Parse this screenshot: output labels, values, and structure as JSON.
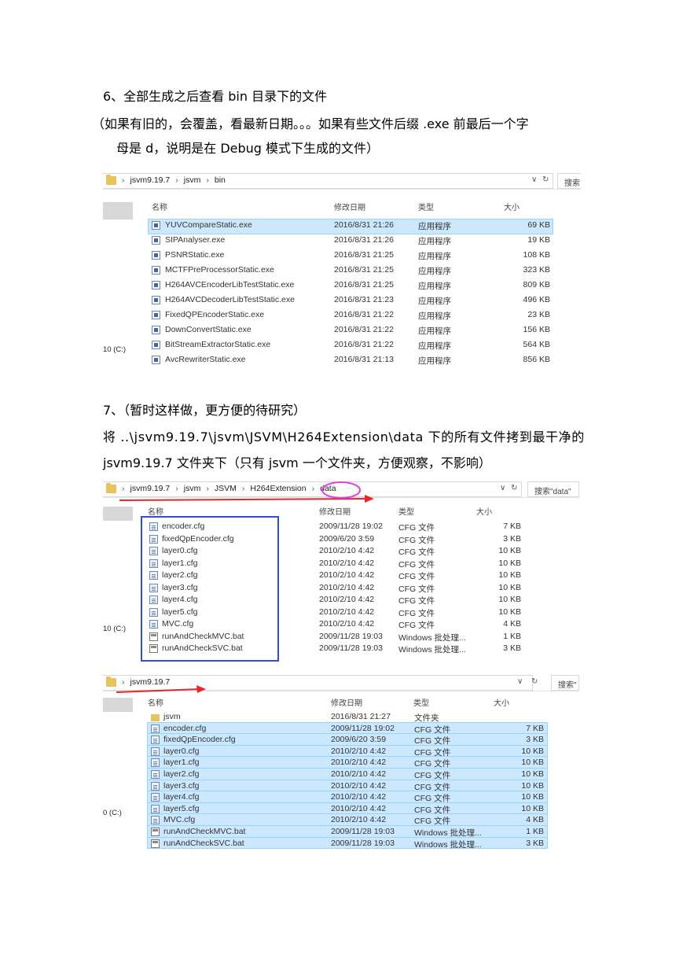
{
  "section6": {
    "heading": "6、全部生成之后查看 bin 目录下的文件",
    "note_line1": "（如果有旧的，会覆盖，看最新日期。。。如果有些文件后缀 .exe 前最后一个字",
    "note_line2": "母是 d，说明是在 Debug 模式下生成的文件）"
  },
  "section7": {
    "heading": "7、（暂时这样做，更方便的待研究）",
    "line1": "将 ..\\jsvm9.19.7\\jsvm\\JSVM\\H264Extension\\data 下的所有文件拷到最干净的",
    "line2": "jsvm9.19.7 文件夹下（只有 jsvm 一个文件夹，方便观察，不影响）"
  },
  "explorer1": {
    "breadcrumb": [
      "jsvm9.19.7",
      "jsvm",
      "bin"
    ],
    "refresh_icon": "refresh-icon",
    "dropdown_icon": "chevron-down-icon",
    "search_label": "搜索",
    "drive_label": "10 (C:)",
    "columns": {
      "name": "名称",
      "date": "修改日期",
      "type": "类型",
      "size": "大小"
    },
    "files": [
      {
        "name": "YUVCompareStatic.exe",
        "date": "2016/8/31 21:26",
        "type": "应用程序",
        "size": "69 KB",
        "selected": true
      },
      {
        "name": "SIPAnalyser.exe",
        "date": "2016/8/31 21:26",
        "type": "应用程序",
        "size": "19 KB"
      },
      {
        "name": "PSNRStatic.exe",
        "date": "2016/8/31 21:25",
        "type": "应用程序",
        "size": "108 KB"
      },
      {
        "name": "MCTFPreProcessorStatic.exe",
        "date": "2016/8/31 21:25",
        "type": "应用程序",
        "size": "323 KB"
      },
      {
        "name": "H264AVCEncoderLibTestStatic.exe",
        "date": "2016/8/31 21:25",
        "type": "应用程序",
        "size": "809 KB"
      },
      {
        "name": "H264AVCDecoderLibTestStatic.exe",
        "date": "2016/8/31 21:23",
        "type": "应用程序",
        "size": "496 KB"
      },
      {
        "name": "FixedQPEncoderStatic.exe",
        "date": "2016/8/31 21:22",
        "type": "应用程序",
        "size": "23 KB"
      },
      {
        "name": "DownConvertStatic.exe",
        "date": "2016/8/31 21:22",
        "type": "应用程序",
        "size": "156 KB"
      },
      {
        "name": "BitStreamExtractorStatic.exe",
        "date": "2016/8/31 21:22",
        "type": "应用程序",
        "size": "564 KB"
      },
      {
        "name": "AvcRewriterStatic.exe",
        "date": "2016/8/31 21:13",
        "type": "应用程序",
        "size": "856 KB"
      }
    ]
  },
  "explorer2": {
    "breadcrumb": [
      "jsvm9.19.7",
      "jsvm",
      "JSVM",
      "H264Extension",
      "data"
    ],
    "search_label": "搜索\"data\"",
    "drive_label": "10 (C:)",
    "columns": {
      "name": "名称",
      "date": "修改日期",
      "type": "类型",
      "size": "大小"
    },
    "files": [
      {
        "name": "encoder.cfg",
        "date": "2009/11/28 19:02",
        "type": "CFG 文件",
        "size": "7 KB",
        "icon": "cfg"
      },
      {
        "name": "fixedQpEncoder.cfg",
        "date": "2009/6/20 3:59",
        "type": "CFG 文件",
        "size": "3 KB",
        "icon": "cfg"
      },
      {
        "name": "layer0.cfg",
        "date": "2010/2/10 4:42",
        "type": "CFG 文件",
        "size": "10 KB",
        "icon": "cfg"
      },
      {
        "name": "layer1.cfg",
        "date": "2010/2/10 4:42",
        "type": "CFG 文件",
        "size": "10 KB",
        "icon": "cfg"
      },
      {
        "name": "layer2.cfg",
        "date": "2010/2/10 4:42",
        "type": "CFG 文件",
        "size": "10 KB",
        "icon": "cfg"
      },
      {
        "name": "layer3.cfg",
        "date": "2010/2/10 4:42",
        "type": "CFG 文件",
        "size": "10 KB",
        "icon": "cfg"
      },
      {
        "name": "layer4.cfg",
        "date": "2010/2/10 4:42",
        "type": "CFG 文件",
        "size": "10 KB",
        "icon": "cfg"
      },
      {
        "name": "layer5.cfg",
        "date": "2010/2/10 4:42",
        "type": "CFG 文件",
        "size": "10 KB",
        "icon": "cfg"
      },
      {
        "name": "MVC.cfg",
        "date": "2010/2/10 4:42",
        "type": "CFG 文件",
        "size": "4 KB",
        "icon": "cfg"
      },
      {
        "name": "runAndCheckMVC.bat",
        "date": "2009/11/28 19:03",
        "type": "Windows 批处理...",
        "size": "1 KB",
        "icon": "bat"
      },
      {
        "name": "runAndCheckSVC.bat",
        "date": "2009/11/28 19:03",
        "type": "Windows 批处理...",
        "size": "3 KB",
        "icon": "bat"
      }
    ]
  },
  "explorer3": {
    "breadcrumb": [
      "jsvm9.19.7"
    ],
    "search_label": "搜索\"",
    "drive_label": "0 (C:)",
    "columns": {
      "name": "名称",
      "date": "修改日期",
      "type": "类型",
      "size": "大小"
    },
    "files": [
      {
        "name": "jsvm",
        "date": "2016/8/31 21:27",
        "type": "文件夹",
        "size": "",
        "icon": "fld"
      },
      {
        "name": "encoder.cfg",
        "date": "2009/11/28 19:02",
        "type": "CFG 文件",
        "size": "7 KB",
        "icon": "cfg",
        "selected": true
      },
      {
        "name": "fixedQpEncoder.cfg",
        "date": "2009/6/20 3:59",
        "type": "CFG 文件",
        "size": "3 KB",
        "icon": "cfg",
        "selected": true
      },
      {
        "name": "layer0.cfg",
        "date": "2010/2/10 4:42",
        "type": "CFG 文件",
        "size": "10 KB",
        "icon": "cfg",
        "selected": true
      },
      {
        "name": "layer1.cfg",
        "date": "2010/2/10 4:42",
        "type": "CFG 文件",
        "size": "10 KB",
        "icon": "cfg",
        "selected": true
      },
      {
        "name": "layer2.cfg",
        "date": "2010/2/10 4:42",
        "type": "CFG 文件",
        "size": "10 KB",
        "icon": "cfg",
        "selected": true
      },
      {
        "name": "layer3.cfg",
        "date": "2010/2/10 4:42",
        "type": "CFG 文件",
        "size": "10 KB",
        "icon": "cfg",
        "selected": true
      },
      {
        "name": "layer4.cfg",
        "date": "2010/2/10 4:42",
        "type": "CFG 文件",
        "size": "10 KB",
        "icon": "cfg",
        "selected": true
      },
      {
        "name": "layer5.cfg",
        "date": "2010/2/10 4:42",
        "type": "CFG 文件",
        "size": "10 KB",
        "icon": "cfg",
        "selected": true
      },
      {
        "name": "MVC.cfg",
        "date": "2010/2/10 4:42",
        "type": "CFG 文件",
        "size": "4 KB",
        "icon": "cfg",
        "selected": true
      },
      {
        "name": "runAndCheckMVC.bat",
        "date": "2009/11/28 19:03",
        "type": "Windows 批处理...",
        "size": "1 KB",
        "icon": "bat",
        "selected": true
      },
      {
        "name": "runAndCheckSVC.bat",
        "date": "2009/11/28 19:03",
        "type": "Windows 批处理...",
        "size": "3 KB",
        "icon": "bat",
        "selected": true
      }
    ]
  },
  "colors": {
    "selection_fill": "#cce8ff",
    "selection_border": "#99d1ff",
    "annotation_red": "#e8262a",
    "annotation_magenta": "#e040e0",
    "annotation_blue": "#2f4fd0",
    "folder_yellow": "#e8c25a"
  }
}
